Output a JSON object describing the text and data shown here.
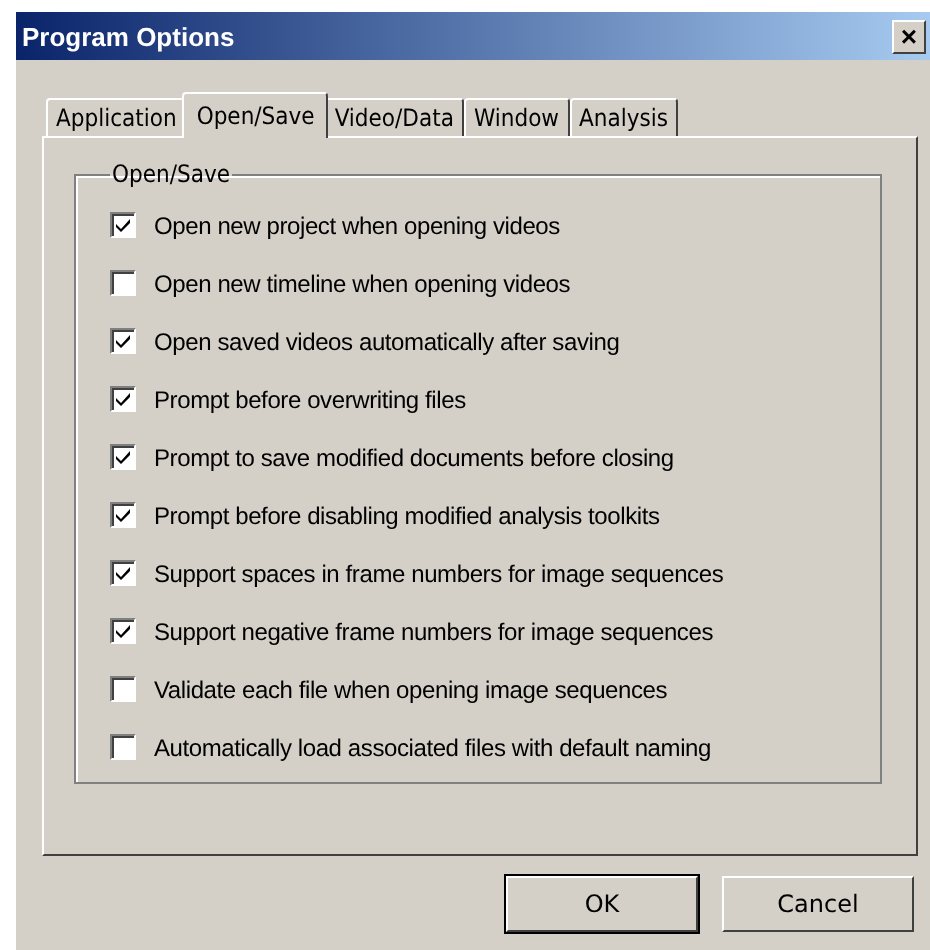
{
  "window": {
    "title": "Program Options",
    "close": "×"
  },
  "tabs": [
    {
      "label": "Application",
      "selected": false
    },
    {
      "label": "Open/Save",
      "selected": true
    },
    {
      "label": "Video/Data",
      "selected": false
    },
    {
      "label": "Window",
      "selected": false
    },
    {
      "label": "Analysis",
      "selected": false
    }
  ],
  "group": {
    "title": "Open/Save",
    "options": [
      {
        "label": "Open new project when opening videos",
        "checked": true
      },
      {
        "label": "Open new timeline when opening videos",
        "checked": false
      },
      {
        "label": "Open saved videos automatically after saving",
        "checked": true
      },
      {
        "label": "Prompt before overwriting files",
        "checked": true
      },
      {
        "label": "Prompt to save modified documents before closing",
        "checked": true
      },
      {
        "label": "Prompt before disabling modified analysis toolkits",
        "checked": true
      },
      {
        "label": "Support spaces in frame numbers for image sequences",
        "checked": true
      },
      {
        "label": "Support negative frame numbers for image sequences",
        "checked": true
      },
      {
        "label": "Validate each file when opening image sequences",
        "checked": false
      },
      {
        "label": "Automatically load associated files with default naming",
        "checked": false
      }
    ]
  },
  "buttons": [
    {
      "label": "OK",
      "default": true
    },
    {
      "label": "Cancel",
      "default": false
    }
  ]
}
